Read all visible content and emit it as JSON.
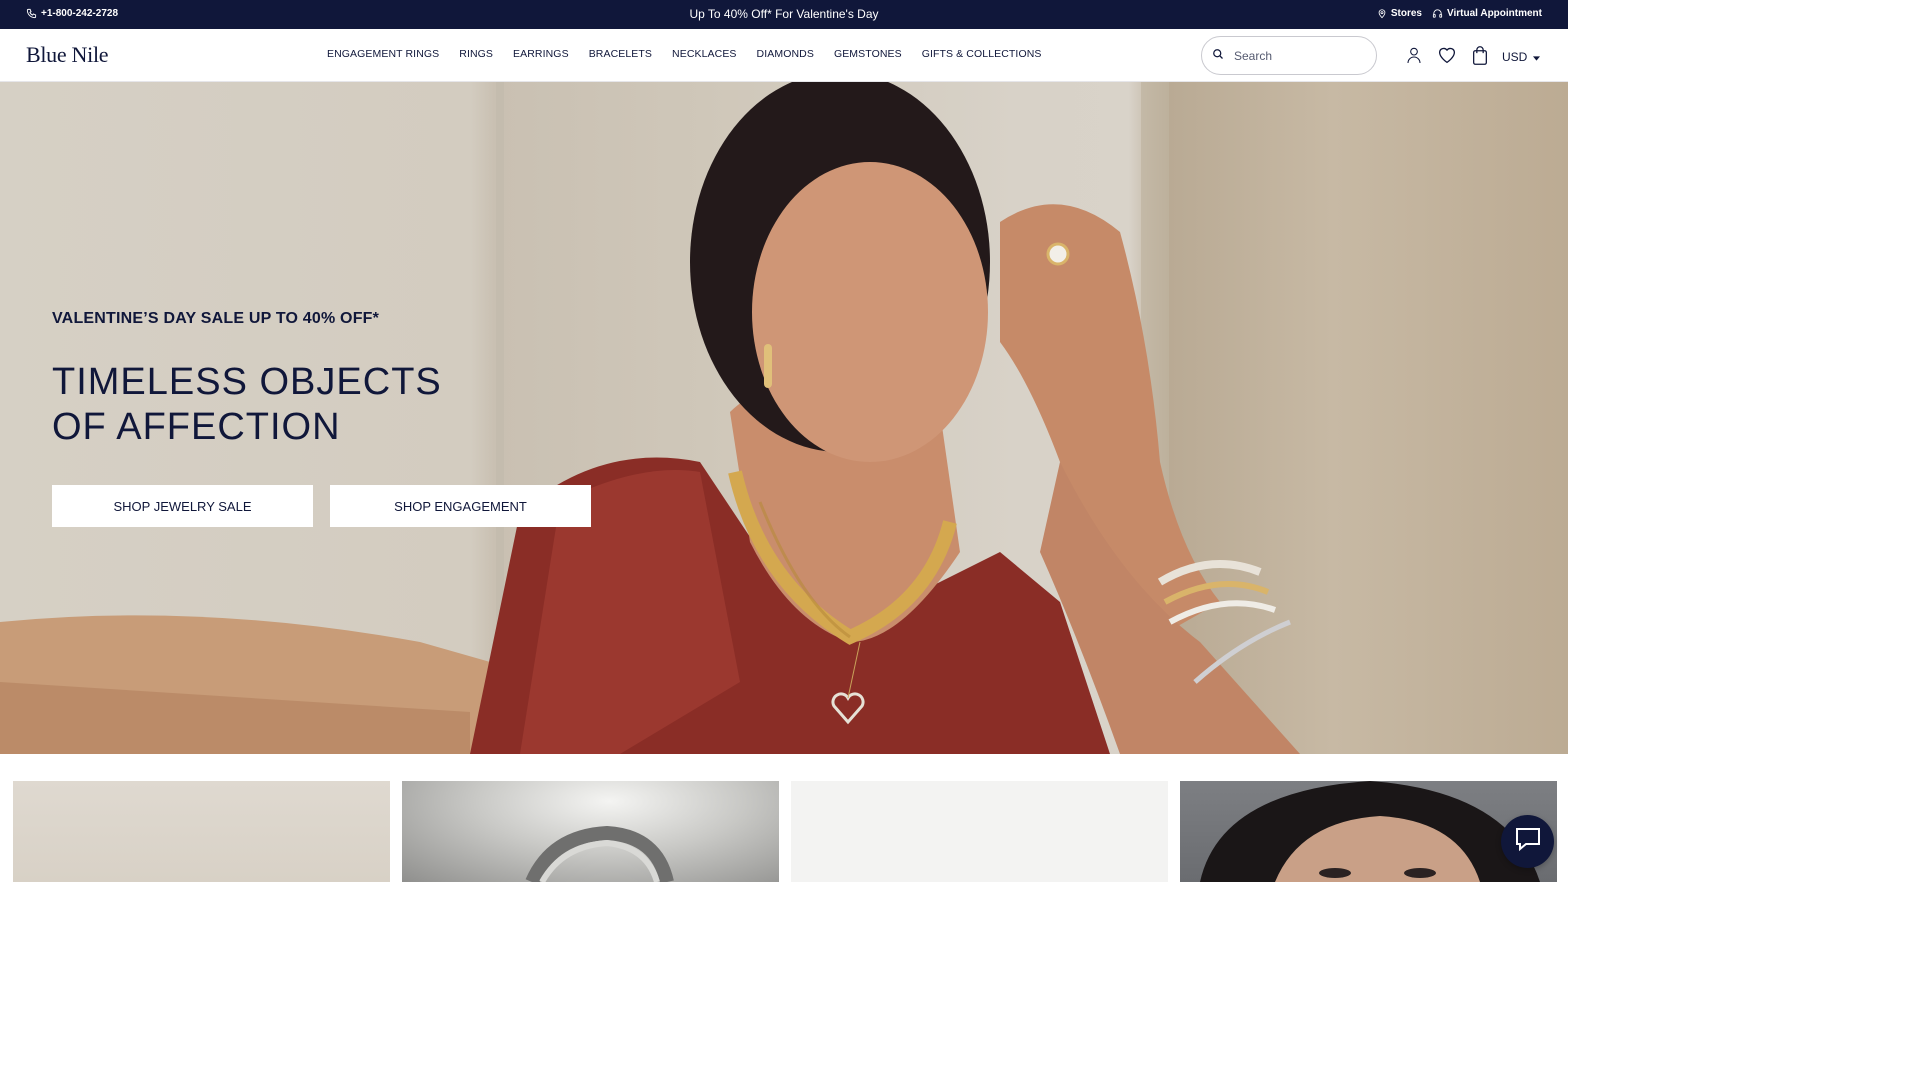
{
  "promo": {
    "phone": "+1-800-242-2728",
    "message": "Up To 40% Off* For Valentine's Day",
    "stores": "Stores",
    "virtual_appointment": "Virtual Appointment"
  },
  "header": {
    "logo": "Blue Nile",
    "nav": [
      "ENGAGEMENT RINGS",
      "RINGS",
      "EARRINGS",
      "BRACELETS",
      "NECKLACES",
      "DIAMONDS",
      "GEMSTONES",
      "GIFTS & COLLECTIONS"
    ],
    "search_placeholder": "Search",
    "currency": "USD"
  },
  "hero": {
    "eyebrow": "VALENTINE’S DAY SALE UP TO 40% OFF*",
    "title_line1": "TIMELESS OBJECTS",
    "title_line2": "OF AFFECTION",
    "cta_primary": "SHOP JEWELRY SALE",
    "cta_secondary": "SHOP ENGAGEMENT"
  },
  "colors": {
    "brand_navy": "#10173a",
    "white": "#ffffff"
  }
}
